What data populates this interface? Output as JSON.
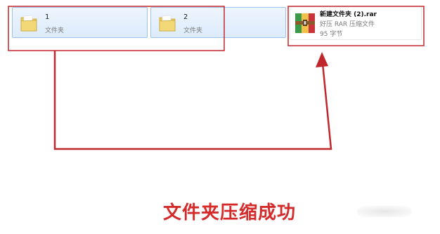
{
  "files": [
    {
      "name": "1",
      "type": "文件夹",
      "icon": "folder-icon"
    },
    {
      "name": "2",
      "type": "文件夹",
      "icon": "folder-icon"
    },
    {
      "name": "新建文件夹 (2).rar",
      "type": "好压 RAR 压缩文件",
      "size": "95 字节",
      "icon": "rar-archive-icon"
    }
  ],
  "caption": "文件夹压缩成功",
  "colors": {
    "annotation_red": "#c0262c",
    "caption_red": "#d42a2a",
    "selection_blue": "#cfe3fb"
  }
}
